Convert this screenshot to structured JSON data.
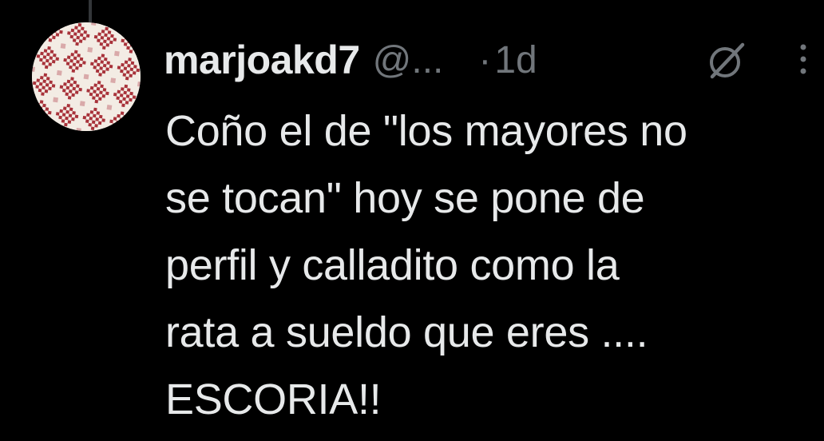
{
  "tweet": {
    "display_name": "marjoakd7",
    "handle": "@...",
    "separator": "·",
    "timestamp": "1d",
    "text": "Coño el de \"los mayores no\nse tocan\" hoy se pone de\nperfil y calladito como la\nrata a sueldo que eres ....\nESCORIA!!"
  },
  "icons": {
    "avatar": "avatar-pattern-icon",
    "grok": "grok-icon",
    "more": "more-icon"
  },
  "colors": {
    "background": "#000000",
    "text_primary": "#e7e9ea",
    "text_secondary": "#71767b",
    "thread_line": "#333639",
    "avatar_pattern": "#a8323a"
  }
}
